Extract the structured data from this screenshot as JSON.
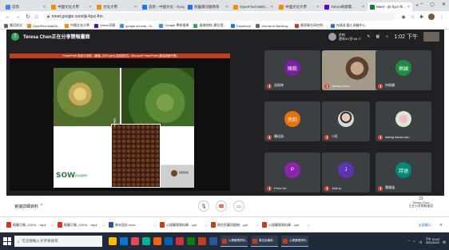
{
  "browser": {
    "tabs": [
      {
        "label": "首頁",
        "color": "#4285f4"
      },
      {
        "label": "中國文化大學",
        "color": "#f28c00"
      },
      {
        "label": "文化大學",
        "color": "#f28c00"
      },
      {
        "label": "首頁 - 中國文化 - Goog...",
        "color": "#1a73e8"
      },
      {
        "label": "校園資訊服務系",
        "color": "#1a73e8"
      },
      {
        "label": "OpenFind MailZ...",
        "color": "#f28c00"
      },
      {
        "label": "中國文化大學",
        "color": "#f28c00"
      },
      {
        "label": "Yahoo奇摩電...",
        "color": "#6001d2"
      },
      {
        "label": "Meet - ijk-fqxz-fh...",
        "color": "#00832d",
        "active": true
      }
    ],
    "newtab": "+",
    "window_controls": [
      "–",
      "▢",
      "✕"
    ],
    "url": "meet.google.com/ijk-fqxz-fhn",
    "bookmarks": [
      {
        "label": "應用程式",
        "color": "#5f6368"
      },
      {
        "label": "OpenFind MailZ8...",
        "color": "#f28c00"
      },
      {
        "label": "中國文化大學",
        "color": "#f28c00"
      },
      {
        "label": "Yahoo奇摩",
        "color": "#6001d2"
      },
      {
        "label": "google scholar - G...",
        "color": "#4285f4"
      },
      {
        "label": "Google 學術搜尋",
        "color": "#4285f4"
      },
      {
        "label": "遠端控制 (單位登...",
        "color": "#34a853"
      },
      {
        "label": "Facebook",
        "color": "#1877f2"
      },
      {
        "label": "Journal of Banking...",
        "color": "#666666"
      },
      {
        "label": "國家衛生研究院...",
        "color": "#d93025"
      },
      {
        "label": "內政部 國土測繪中心",
        "color": "#1a73e8"
      }
    ]
  },
  "meet": {
    "presenter_initial": "T",
    "presenting_text": "Teresa Chen正在分享簡報畫面",
    "account_name": "於柏",
    "account_sub": "還有33 秒 66 人",
    "clock": "1:02 下午",
    "presentation_title": "PowerPoint 投影片放映 - [藥植_0519.pptx] [相容模式] - Microsoft PowerPoint (產品啟動失敗)",
    "slide_logo": "SOW",
    "slide_logo_sub": "原生植物學",
    "slide_caption": "吉木子",
    "slide_logo2_text": "藥用植物",
    "participants": [
      {
        "name": "吳佩婷",
        "initial": "陳毅",
        "color": "#7b1fa2",
        "type": "avatar"
      },
      {
        "name": "Teresa Chen",
        "type": "video"
      },
      {
        "name": "何佩穎",
        "initial": "佩穎",
        "color": "#1e8e3e",
        "type": "avatar"
      },
      {
        "name": "陳佳鈞",
        "initial": "亮鈞",
        "color": "#e8710a",
        "type": "avatar"
      },
      {
        "name": "小紅",
        "type": "photo"
      },
      {
        "name": "cheng hsuan chu",
        "type": "flower"
      },
      {
        "name": "Peko Hu",
        "initial": "P",
        "color": "#8e24aa",
        "type": "avatar"
      },
      {
        "name": "Julie jo",
        "initial": "J",
        "color": "#5e35b1",
        "type": "avatar"
      },
      {
        "name": "葉韻涵",
        "initial": "詩涵",
        "color": "#00897b",
        "type": "avatar"
      }
    ]
  },
  "controls": {
    "meeting_details": "會議詳細資料",
    "chevron": "^",
    "mic_icon": "🎙",
    "hangup_icon": "☎",
    "camera_icon": "▭",
    "present_now_line1": "Teresa Chen",
    "present_now_line2": "正在分享簡報畫面"
  },
  "downloads": {
    "items": [
      {
        "label": "植藥月報_20210....mp4",
        "color": "#d93025"
      },
      {
        "label": "植藥月報_20210....mp4",
        "color": "#d93025"
      },
      {
        "label": "期末設計.docx",
        "color": "#2b579a"
      },
      {
        "label": "心理藥理資料庫....ppt",
        "color": "#c43e1c"
      },
      {
        "label": "原住民藥用植物....ppt",
        "color": "#c43e1c"
      },
      {
        "label": "心理藥理資料庫....ppt",
        "color": "#c43e1c"
      }
    ],
    "show_all": "全部顯示",
    "close": "✕"
  },
  "taskbar": {
    "search_placeholder": "在這裡輸入文字來搜尋",
    "apps": [
      "#ffb900",
      "#0078d7",
      "#e74856",
      "#00b294",
      "#f7630c",
      "#0063b1",
      "#d13438",
      "#107c10",
      "#c43e1c",
      "#2b579a"
    ],
    "tasks": [
      {
        "label": "心理藥理資料...",
        "color": "#c43e1c"
      },
      {
        "label": "原住民藥用...",
        "color": "#c43e1c"
      },
      {
        "label": "心理藥理資料...",
        "color": "#c43e1c"
      }
    ],
    "time": "下午 01:02",
    "date": "2021/5/19"
  }
}
